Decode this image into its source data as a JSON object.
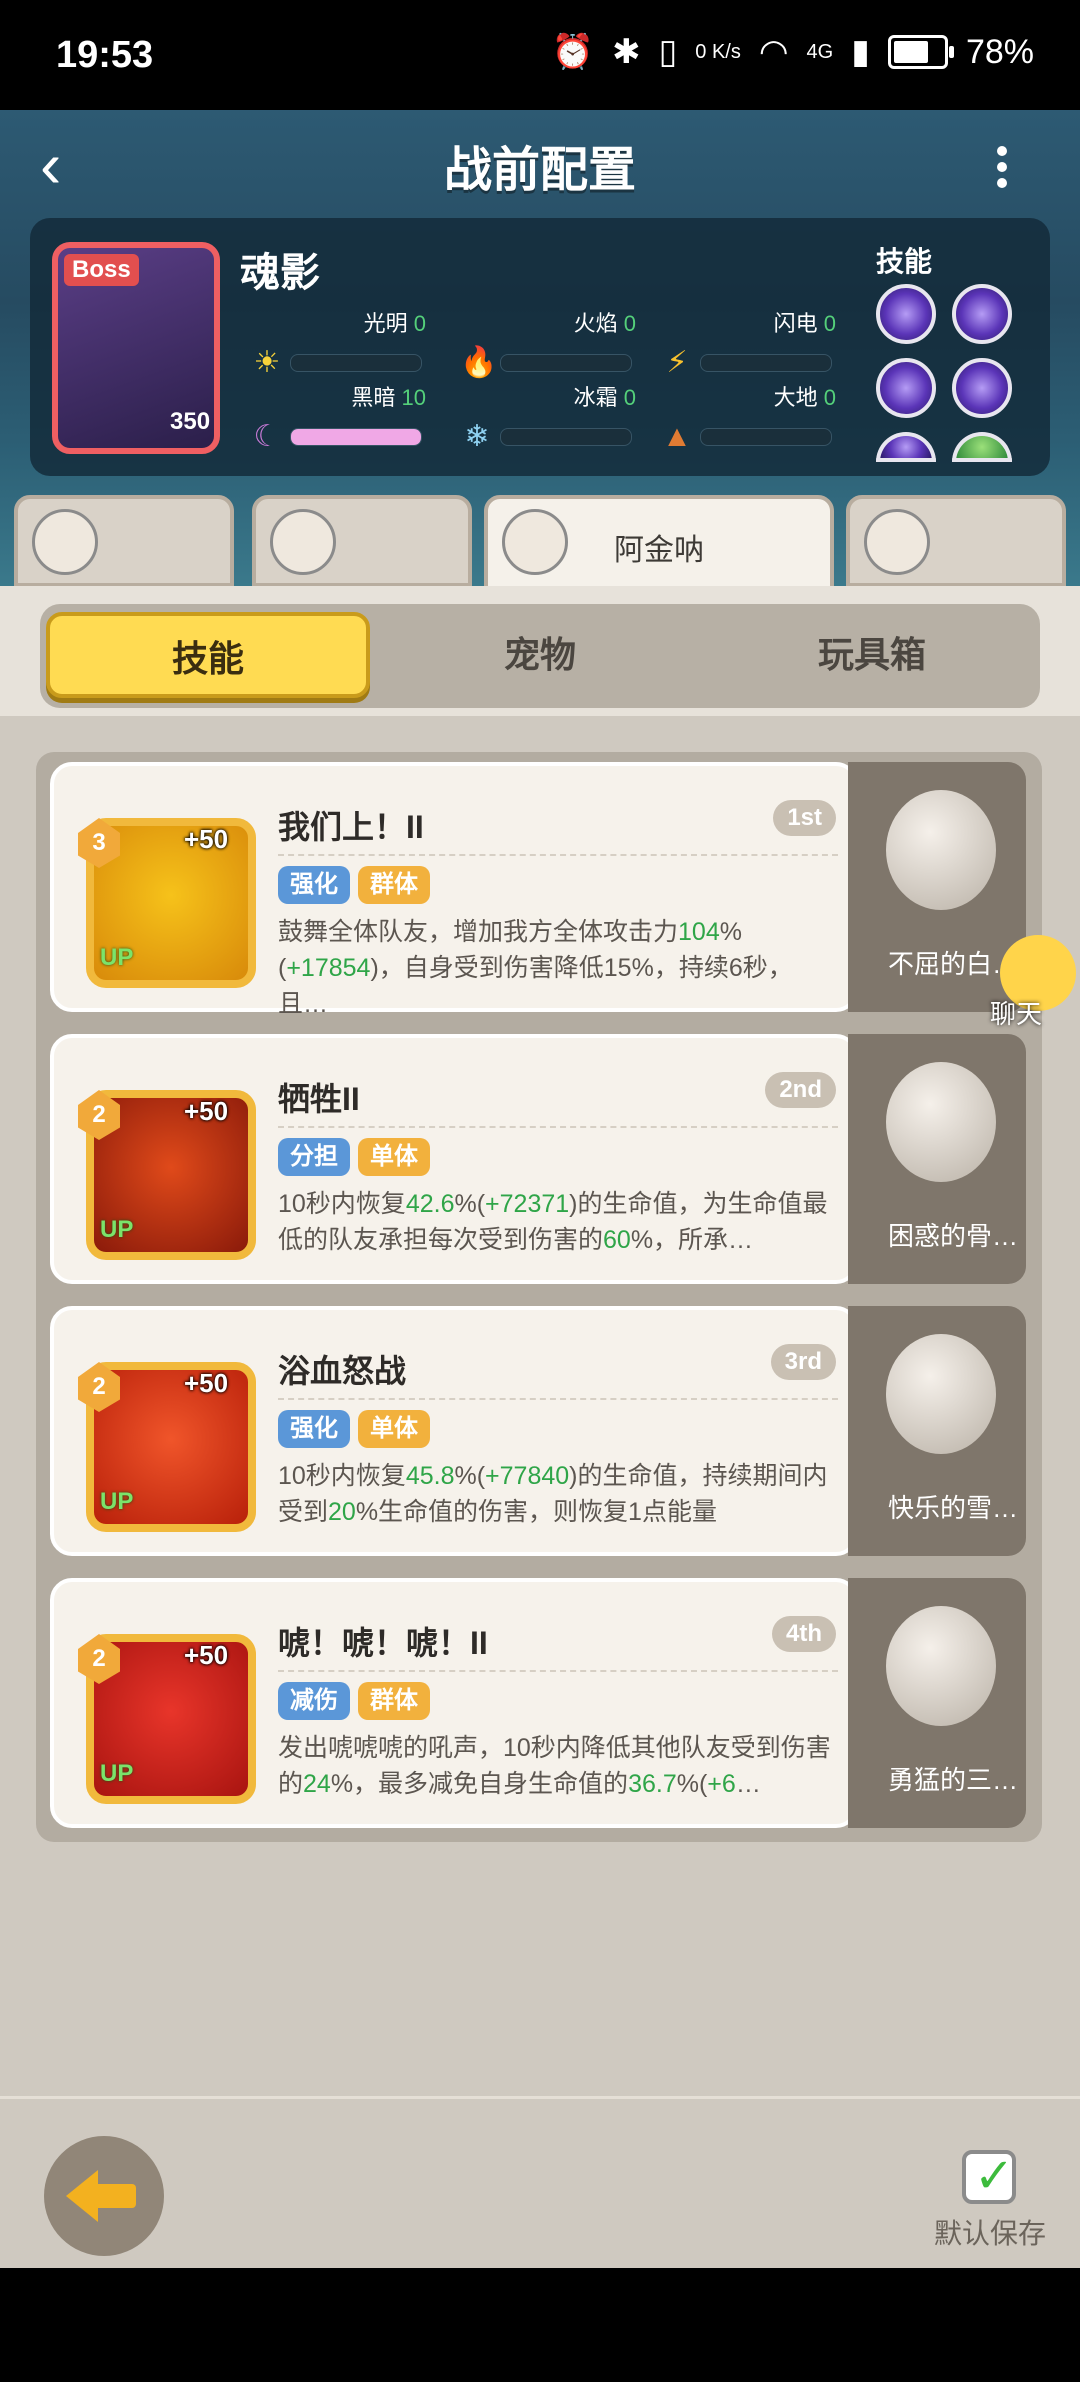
{
  "status_bar": {
    "time": "19:53",
    "net": "0 K/s",
    "signal": "4G",
    "battery": "78%",
    "battery_level": 0.78
  },
  "header": {
    "title": "战前配置"
  },
  "boss": {
    "tag": "Boss",
    "name": "魂影",
    "level": "350",
    "skills_label": "技能",
    "attributes": [
      {
        "name": "光明",
        "value": "0",
        "icon": "sun-icon",
        "fill": 0
      },
      {
        "name": "火焰",
        "value": "0",
        "icon": "fire-icon",
        "fill": 0
      },
      {
        "name": "闪电",
        "value": "0",
        "icon": "lightning-icon",
        "fill": 0
      },
      {
        "name": "黑暗",
        "value": "10",
        "icon": "moon-icon",
        "fill": 1
      },
      {
        "name": "冰霜",
        "value": "0",
        "icon": "snowflake-icon",
        "fill": 0
      },
      {
        "name": "大地",
        "value": "0",
        "icon": "earth-icon",
        "fill": 0
      }
    ]
  },
  "hero_tabs": [
    {
      "name": ""
    },
    {
      "name": ""
    },
    {
      "name": "阿金呐",
      "active": true
    },
    {
      "name": ""
    }
  ],
  "tabs": [
    {
      "label": "技能",
      "active": true
    },
    {
      "label": "宠物"
    },
    {
      "label": "玩具箱"
    }
  ],
  "skills": [
    {
      "level": "3",
      "bonus": "+50",
      "up": "UP",
      "name": "我们上！II",
      "rank": "1st",
      "tags": [
        {
          "label": "强化",
          "color": "blue"
        },
        {
          "label": "群体",
          "color": "orange"
        }
      ],
      "desc_parts": [
        "鼓舞全体队友，增加我方全体攻击力",
        "104",
        "%(",
        "+17854",
        ")，自身受到伤害降低15%，持续6秒，且",
        "…"
      ],
      "pet_name": "不屈的白…",
      "icon_colors": [
        "#f6c21a",
        "#d88a0a"
      ]
    },
    {
      "level": "2",
      "bonus": "+50",
      "up": "UP",
      "name": "牺牲II",
      "rank": "2nd",
      "tags": [
        {
          "label": "分担",
          "color": "blue"
        },
        {
          "label": "单体",
          "color": "orange"
        }
      ],
      "desc_parts": [
        "10秒内恢复",
        "42.6",
        "%(",
        "+72371",
        ")的生命值，为生命值最低的队友承担每次受到伤害的",
        "60",
        "%，所承…"
      ],
      "pet_name": "困惑的骨…",
      "icon_colors": [
        "#e04a1a",
        "#8a1a0a"
      ]
    },
    {
      "level": "2",
      "bonus": "+50",
      "up": "UP",
      "name": "浴血怒战",
      "rank": "3rd",
      "tags": [
        {
          "label": "强化",
          "color": "blue"
        },
        {
          "label": "单体",
          "color": "orange"
        }
      ],
      "desc_parts": [
        "10秒内恢复",
        "45.8",
        "%(",
        "+77840",
        ")的生命值，持续期间内受到",
        "20",
        "%生命值的伤害，则恢复1点能量"
      ],
      "pet_name": "快乐的雪…",
      "icon_colors": [
        "#f0552a",
        "#b8200a"
      ]
    },
    {
      "level": "2",
      "bonus": "+50",
      "up": "UP",
      "name": "唬！唬！唬！II",
      "rank": "4th",
      "tags": [
        {
          "label": "减伤",
          "color": "blue"
        },
        {
          "label": "群体",
          "color": "orange"
        }
      ],
      "desc_parts": [
        "发出唬唬唬的吼声，10秒内降低其他队友受到伤害的",
        "24",
        "%，最多减免自身生命值的",
        "36.7",
        "%(",
        "+6",
        "…"
      ],
      "pet_name": "勇猛的三…",
      "icon_colors": [
        "#e8352a",
        "#a81410"
      ]
    }
  ],
  "chat": {
    "label": "聊天"
  },
  "bottom": {
    "save_label": "默认保存"
  }
}
